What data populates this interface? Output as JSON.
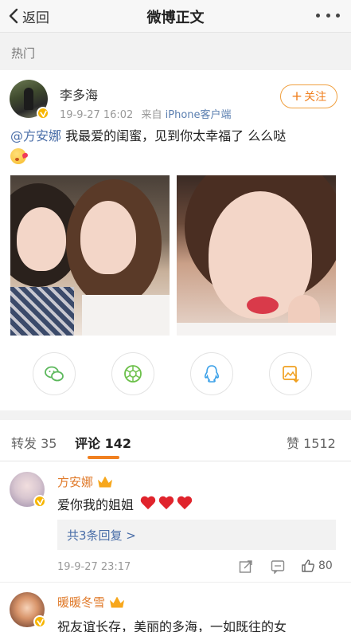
{
  "nav": {
    "back_label": "返回",
    "title": "微博正文"
  },
  "section_label": "热门",
  "post": {
    "author": "李多海",
    "time": "19-9-27 16:02",
    "source_prefix": "来自",
    "source": "iPhone客户端",
    "follow_label": "关注",
    "mention": "@方安娜",
    "text": " 我最爱的闺蜜，见到你太幸福了 么么哒",
    "share_icons": [
      "wechat-icon",
      "moments-icon",
      "qq-icon",
      "save-image-icon"
    ]
  },
  "tabs": {
    "repost_label": "转发",
    "repost_count": "35",
    "comment_label": "评论",
    "comment_count": "142",
    "like_label": "赞",
    "like_count": "1512"
  },
  "comments": [
    {
      "name": "方安娜",
      "text": "爱你我的姐姐",
      "replies_label": "共3条回复 >",
      "time": "19-9-27 23:17",
      "likes": "80"
    },
    {
      "name": "暖暖冬雪",
      "text": "祝友谊长存，美丽的多海，一如既往的女"
    }
  ],
  "colors": {
    "accent": "#f08020",
    "link": "#4a6ea8",
    "verified": "#f7b500"
  }
}
